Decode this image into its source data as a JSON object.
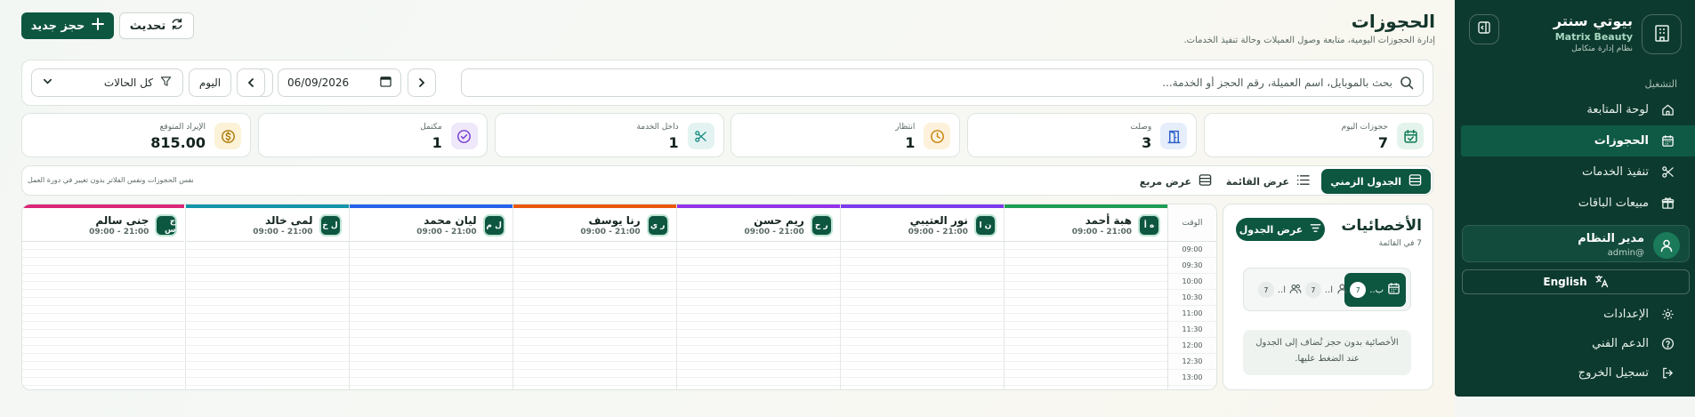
{
  "sidebar": {
    "brand_name": "بيوتي سنتر",
    "brand_en": "Matrix Beauty",
    "brand_sub": "نظام إدارة متكامل",
    "section_label": "التشغيل",
    "items": [
      {
        "label": "لوحة المتابعة",
        "icon": "home-icon"
      },
      {
        "label": "الحجوزات",
        "icon": "calendar-icon",
        "active": true
      },
      {
        "label": "تنفيذ الخدمات",
        "icon": "scissors-icon"
      },
      {
        "label": "مبيعات الباقات",
        "icon": "gift-icon"
      }
    ],
    "user": {
      "name": "مدير النظام",
      "handle": "@admin"
    },
    "language": "English",
    "bottom_items": [
      {
        "label": "الإعدادات",
        "icon": "gear-icon"
      },
      {
        "label": "الدعم الفني",
        "icon": "help-icon"
      },
      {
        "label": "تسجيل الخروج",
        "icon": "logout-icon"
      }
    ]
  },
  "header": {
    "title": "الحجوزات",
    "subtitle": "إدارة الحجوزات اليومية، متابعة وصول العميلات وحالة تنفيذ الخدمات.",
    "new_booking": "حجز جديد",
    "refresh": "تحديث"
  },
  "filters": {
    "search_placeholder": "بحث بالموبايل، اسم العميلة، رقم الحجز أو الخدمة...",
    "date": "06/09/2026",
    "today": "اليوم",
    "status": "كل الحالات"
  },
  "stats": [
    {
      "label": "حجوزات اليوم",
      "value": "7",
      "icon": "calendar-check-icon",
      "bg": "#e4f4ec",
      "fg": "#0d7a55"
    },
    {
      "label": "وصلت",
      "value": "3",
      "icon": "door-icon",
      "bg": "#e6eefb",
      "fg": "#2f62c9"
    },
    {
      "label": "انتظار",
      "value": "1",
      "icon": "clock-icon",
      "bg": "#fdf1dc",
      "fg": "#c88411"
    },
    {
      "label": "داخل الخدمة",
      "value": "1",
      "icon": "scissors-icon",
      "bg": "#e3f3f2",
      "fg": "#118a7e"
    },
    {
      "label": "مكتمل",
      "value": "1",
      "icon": "check-circle-icon",
      "bg": "#efe8fb",
      "fg": "#7a3fd1"
    },
    {
      "label": "الإيراد المتوقع",
      "value": "815.00",
      "icon": "coin-icon",
      "bg": "#fbf2d8",
      "fg": "#b07d0c"
    }
  ],
  "views": {
    "timeline": "الجدول الزمني",
    "list": "عرض القائمة",
    "grid": "عرض مربع",
    "note": "نفس الحجوزات ونفس الفلاتر بدون تغيير في دورة العمل"
  },
  "specialists": {
    "title": "الأخصائيات",
    "count_text": "7 في القائمة",
    "view_table": "عرض الجدول",
    "tabs": [
      {
        "label": "ب..",
        "count": "7",
        "icon": "calendar-icon",
        "active": true
      },
      {
        "label": "ا..",
        "count": "7",
        "icon": "user-icon"
      },
      {
        "label": "ا..",
        "count": "7",
        "icon": "users-icon"
      }
    ],
    "hint": "الأخصائية بدون حجز تُضاف إلى الجدول عند الضغط عليها."
  },
  "timeline": {
    "time_header": "الوقت",
    "slots": [
      "09:00",
      "09:30",
      "10:00",
      "10:30",
      "11:00",
      "11:30",
      "12:00",
      "12:30",
      "13:00"
    ],
    "staff": [
      {
        "initials": "ه أ",
        "name": "هبة أحمد",
        "hours": "09:00 - 21:00",
        "color": "#1f9d55"
      },
      {
        "initials": "ن ا",
        "name": "نور العتيبي",
        "hours": "09:00 - 21:00",
        "color": "#7c3aed"
      },
      {
        "initials": "ر ح",
        "name": "ريم حسن",
        "hours": "09:00 - 21:00",
        "color": "#9333ea"
      },
      {
        "initials": "ر ي",
        "name": "رنا يوسف",
        "hours": "09:00 - 21:00",
        "color": "#ea580c"
      },
      {
        "initials": "ل م",
        "name": "ليان محمد",
        "hours": "09:00 - 21:00",
        "color": "#2563eb"
      },
      {
        "initials": "ل خ",
        "name": "لمى خالد",
        "hours": "09:00 - 21:00",
        "color": "#0e95a8"
      },
      {
        "initials": "ج س",
        "name": "جنى سالم",
        "hours": "09:00 - 21:00",
        "color": "#db2777"
      }
    ]
  }
}
